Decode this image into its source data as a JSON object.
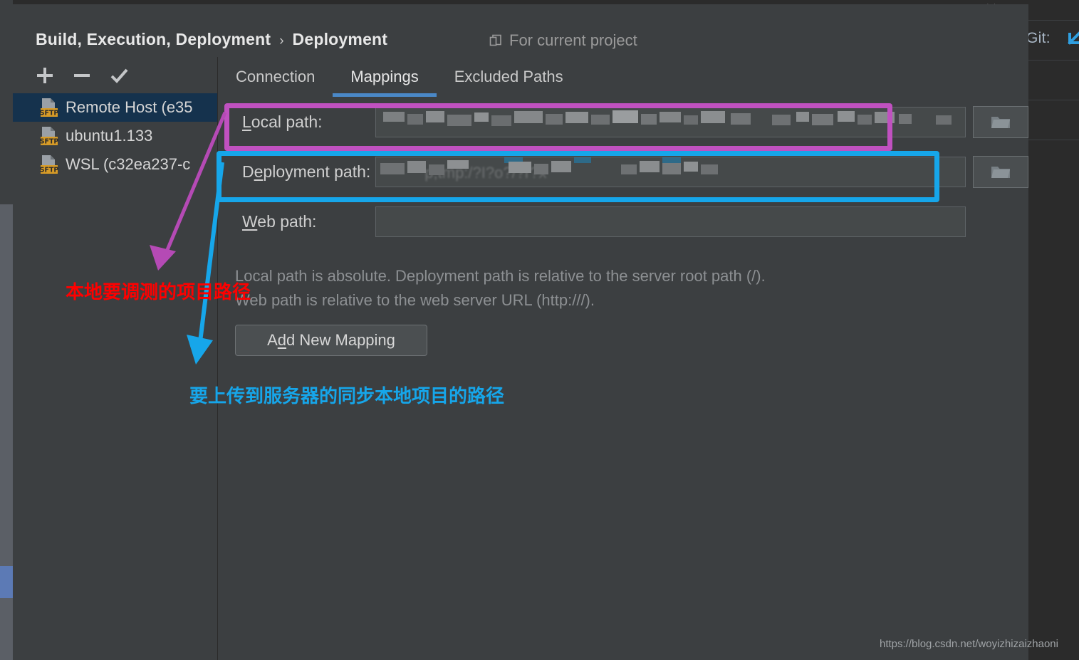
{
  "window": {
    "background_color": "#2b2b2b",
    "panel_color": "#3c3f41",
    "accent_color": "#4a88c7",
    "selection_color": "#15324d"
  },
  "header": {
    "breadcrumb_root": "Build, Execution, Deployment",
    "breadcrumb_separator": "›",
    "breadcrumb_leaf": "Deployment",
    "scope_icon": "copy-icon",
    "scope_label": "For current project"
  },
  "list_toolbar": {
    "add_label": "+",
    "remove_label": "−",
    "set_default_label": "✓"
  },
  "hosts": [
    {
      "label": "Remote Host (e35",
      "icon": "sftp-server-icon",
      "selected": true
    },
    {
      "label": "ubuntu1.133",
      "icon": "sftp-server-icon",
      "selected": false
    },
    {
      "label": "WSL (c32ea237-c",
      "icon": "sftp-server-icon",
      "selected": false
    }
  ],
  "tabs": [
    {
      "label": "Connection",
      "active": false
    },
    {
      "label": "Mappings",
      "active": true
    },
    {
      "label": "Excluded Paths",
      "active": false
    }
  ],
  "form": {
    "rows": [
      {
        "label_prefix": "L",
        "label_mnemonic": "",
        "label": "Local path:",
        "value": "",
        "value_censored": true,
        "browse_icon": "folder-icon"
      },
      {
        "label": "Deployment path:",
        "value": "",
        "value_ghost": "p;tmp:/?I?o?/?r?x",
        "value_censored": true,
        "browse_icon": "folder-icon"
      },
      {
        "label": "Web path:",
        "value": "",
        "value_censored": false,
        "browse_icon": null
      }
    ],
    "local_path_label": "Local path:",
    "deployment_path_label": "Deployment path:",
    "web_path_label": "Web path:"
  },
  "help": {
    "line1": "Local path is absolute. Deployment path is relative to the server root path (/).",
    "line2": "Web path is relative to the web server URL (http:///)."
  },
  "buttons": {
    "add_new_mapping": "Add New Mapping",
    "add_new_mapping_pre": "A",
    "add_new_mapping_mnemonic": "d",
    "add_new_mapping_post": "d New Mapping"
  },
  "editor_chrome": {
    "git_label": "Git:",
    "git_arrow_icon": "arrow-down-left-icon"
  },
  "annotations": [
    {
      "id": "local-path-highlight",
      "shape": "rectangle",
      "color": "#c051c0",
      "target": "Local path row"
    },
    {
      "id": "deployment-path-highlight",
      "shape": "rectangle",
      "color": "#16a6ea",
      "target": "Deployment path row"
    },
    {
      "id": "local-path-note",
      "text": "本地要调测的项目路径",
      "color": "#ff0000"
    },
    {
      "id": "deployment-path-note",
      "text": "要上传到服务器的同步本地项目的路径",
      "color": "#16a6ea"
    }
  ],
  "watermark": {
    "url": "https://blog.csdn.net/woyizhizaizhaoni"
  }
}
